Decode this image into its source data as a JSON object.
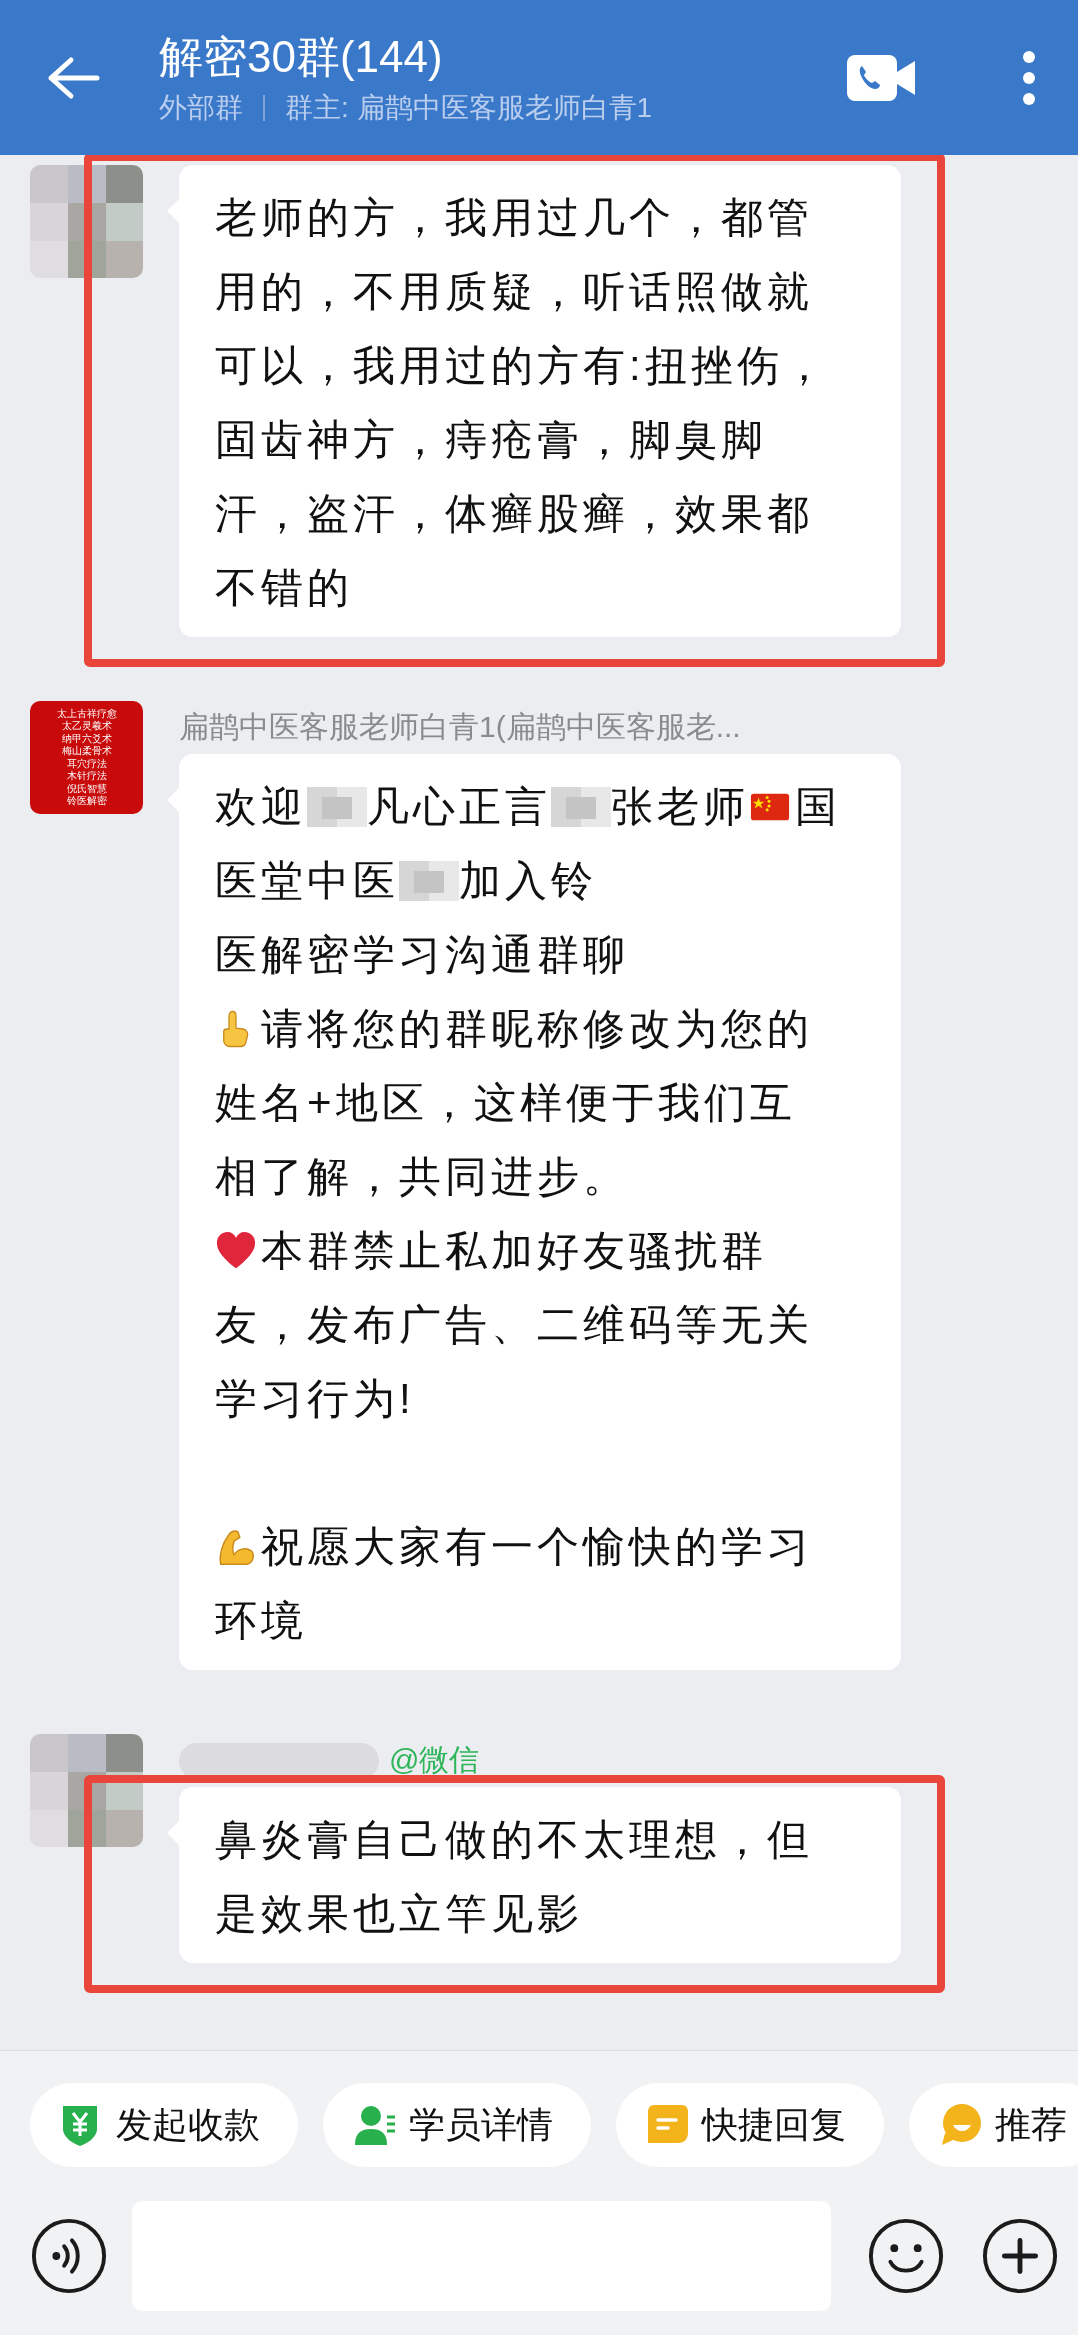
{
  "header": {
    "title": "解密30群(144)",
    "tag": "外部群",
    "owner": "群主: 扁鹊中医客服老师白青1"
  },
  "messages": [
    {
      "avatar": {
        "kind": "picture"
      },
      "highlighted": true,
      "lines": [
        [
          "老师的方，我用过几个，都管"
        ],
        [
          "用的，不用质疑，听话照做就"
        ],
        [
          "可以，我用过的方有:扭挫伤，"
        ],
        [
          "固齿神方，痔疮膏，脚臭脚"
        ],
        [
          "汗，盗汗，体癣股癣，效果都"
        ],
        [
          "不错的"
        ]
      ]
    },
    {
      "avatar": {
        "kind": "text",
        "lines": [
          "太上古祥疗愈",
          "太乙灵羲术",
          "纳甲六爻术",
          "梅山柔骨术",
          "耳穴疗法",
          "木针疗法",
          "倪氏智慧",
          "铃医解密"
        ]
      },
      "sender": {
        "text": "扁鹊中医客服老师白青1(扁鹊中医客服老...",
        "kind": "internal",
        "blurred": false
      },
      "highlighted": false,
      "lines": [
        [
          "欢迎",
          {
            "kind": "blur"
          },
          "凡心正言",
          {
            "kind": "blur"
          },
          "张老师",
          {
            "kind": "flag"
          },
          "国"
        ],
        [
          "医堂中医",
          {
            "kind": "blur"
          },
          "加入铃"
        ],
        [
          "医解密学习沟通群聊"
        ],
        [
          {
            "kind": "point"
          },
          "请将您的群昵称修改为您的"
        ],
        [
          "姓名+地区，这样便于我们互"
        ],
        [
          "相了解，共同进步。"
        ],
        [
          {
            "kind": "heart"
          },
          "本群禁止私加好友骚扰群"
        ],
        [
          "友，发布广告、二维码等无关"
        ],
        [
          "学习行为!"
        ],
        [
          {
            "kind": "blank"
          }
        ],
        [
          {
            "kind": "arm"
          },
          "祝愿大家有一个愉快的学习"
        ],
        [
          "环境"
        ]
      ]
    },
    {
      "avatar": {
        "kind": "picture"
      },
      "sender": {
        "text": "@微信",
        "kind": "external",
        "blurred": true
      },
      "highlighted": true,
      "lines": [
        [
          "鼻炎膏自己做的不太理想，但"
        ],
        [
          "是效果也立竿见影"
        ]
      ]
    }
  ],
  "quick_actions": [
    {
      "label": "发起收款",
      "kind": "payment"
    },
    {
      "label": "学员详情",
      "kind": "student"
    },
    {
      "label": "快捷回复",
      "kind": "reply"
    },
    {
      "label": "推荐",
      "kind": "recommend"
    }
  ]
}
